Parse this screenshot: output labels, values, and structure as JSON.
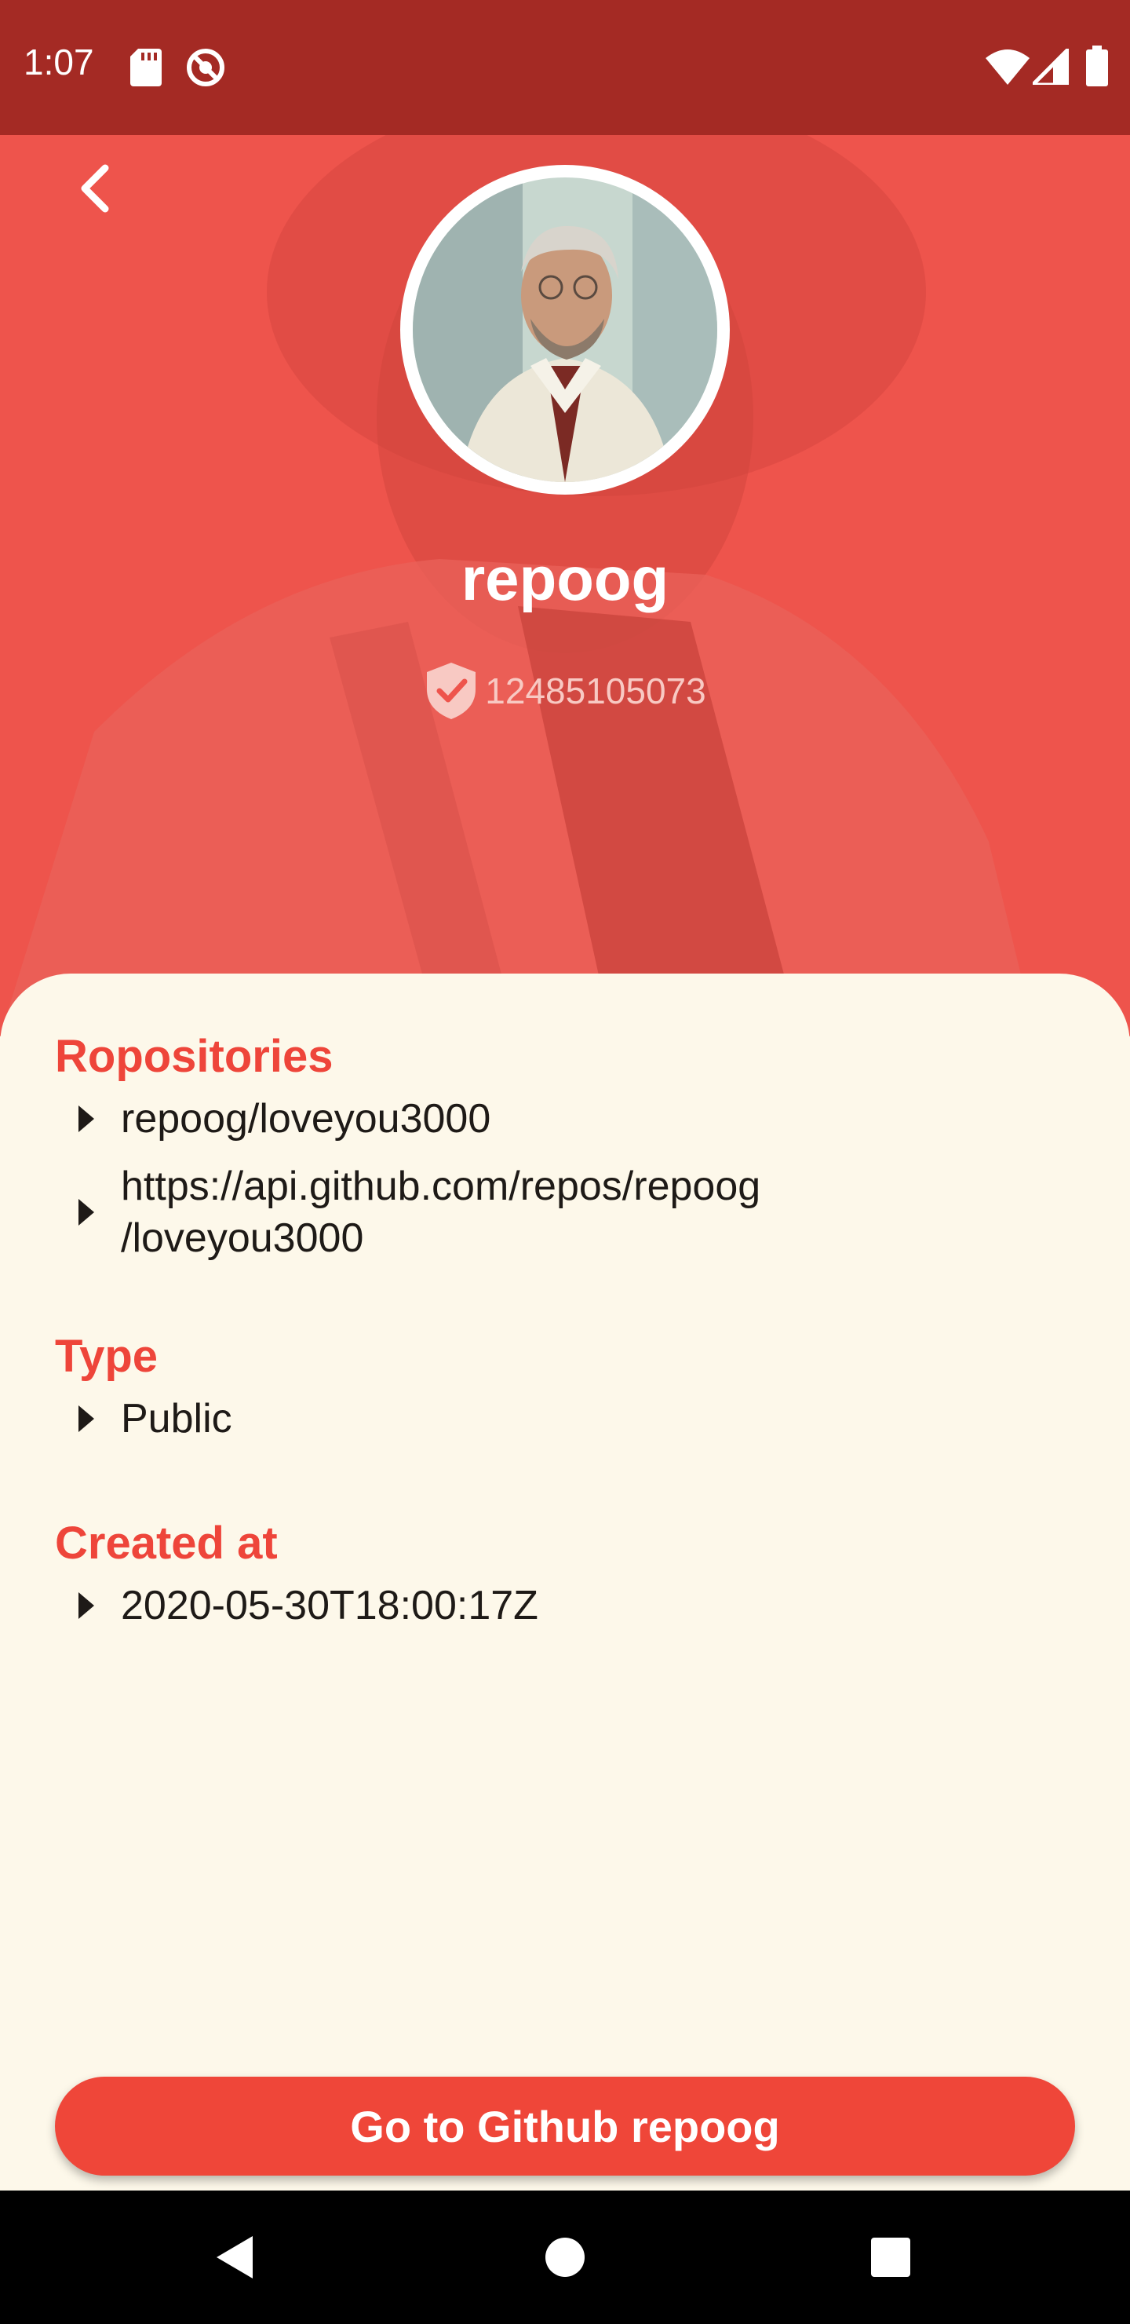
{
  "status_bar": {
    "time": "1:07",
    "icons": [
      "sd-card-icon",
      "do-not-disturb-icon",
      "wifi-icon",
      "signal-icon",
      "battery-icon"
    ]
  },
  "header": {
    "back_icon": "chevron-left-icon",
    "username": "repoog",
    "user_id": "12485105073",
    "verified_icon": "verified-shield-icon",
    "background_color": "#ee544c"
  },
  "sections": {
    "repositories": {
      "title": "Ropositories",
      "items": [
        "repoog/loveyou3000",
        "https://api.github.com/repos/repoog",
        "/loveyou3000"
      ]
    },
    "type": {
      "title": "Type",
      "items": [
        "Public"
      ]
    },
    "created_at": {
      "title": "Created at",
      "items": [
        "2020-05-30T18:00:17Z"
      ]
    }
  },
  "cta": {
    "label": "Go to Github repoog",
    "color": "#ef4639"
  },
  "nav_bar": {
    "icons": [
      "back-triangle-icon",
      "home-circle-icon",
      "recents-square-icon"
    ]
  },
  "colors": {
    "accent": "#ee453a",
    "card_background": "#fdf8ea",
    "text": "#1e1a17"
  }
}
